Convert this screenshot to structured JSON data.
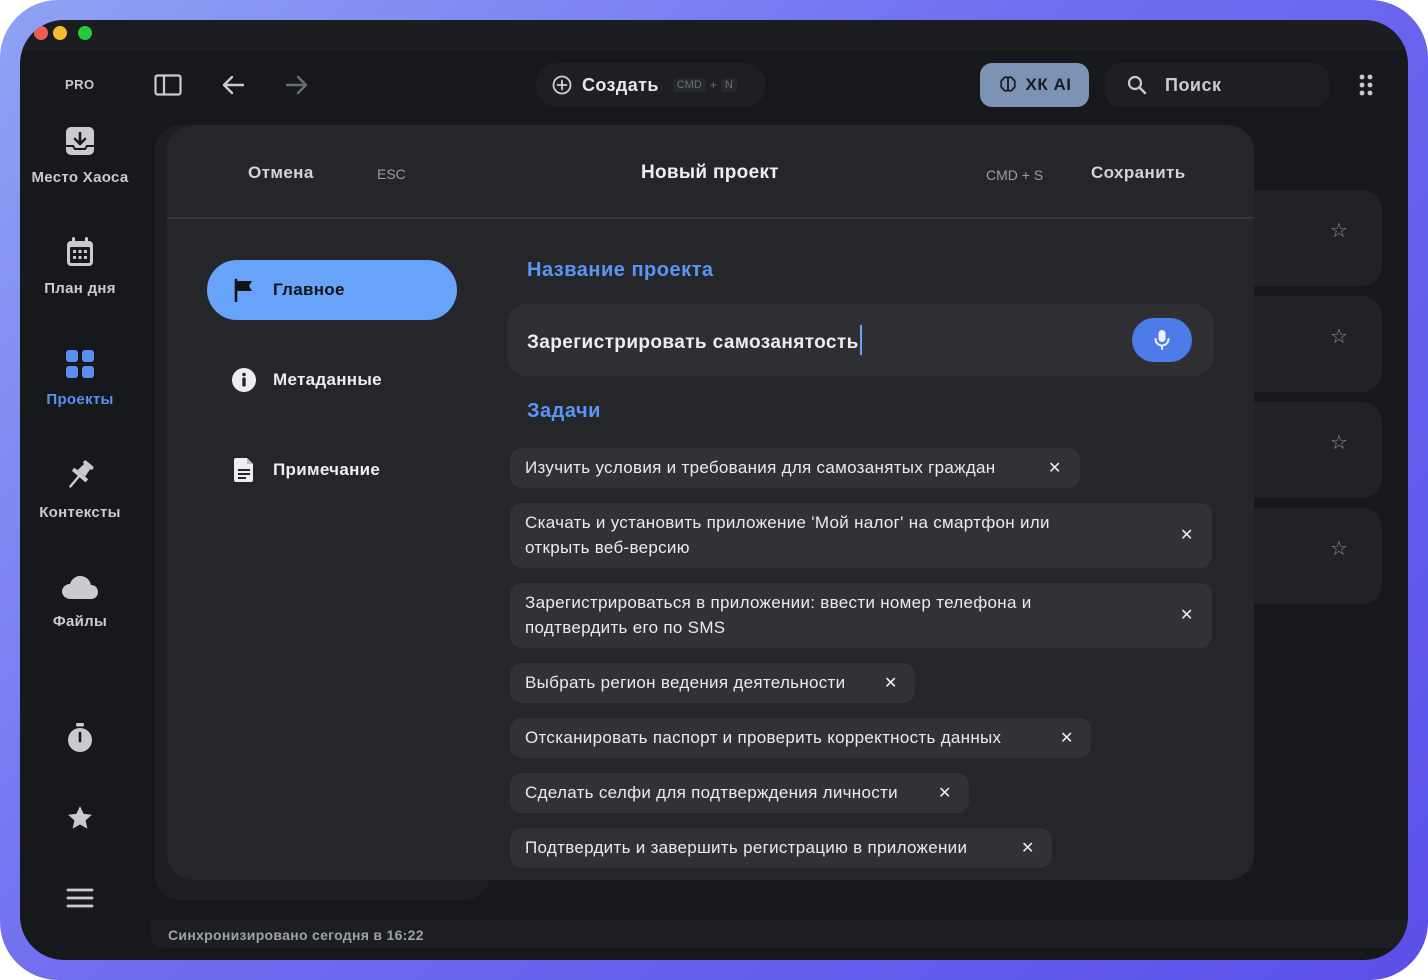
{
  "app": {
    "plan_badge": "PRO",
    "status": "Синхронизировано сегодня в 16:22"
  },
  "toolbar": {
    "create_label": "Создать",
    "create_shortcut_1": "CMD",
    "create_shortcut_plus": "+",
    "create_shortcut_2": "N",
    "ai_label": "ХК AI",
    "search_placeholder": "Поиск"
  },
  "sidebar": {
    "items": [
      {
        "label": "Место Хаоса",
        "icon": "inbox-icon"
      },
      {
        "label": "План дня",
        "icon": "calendar-icon"
      },
      {
        "label": "Проекты",
        "icon": "grid-icon",
        "active": true
      },
      {
        "label": "Контексты",
        "icon": "pin-icon"
      },
      {
        "label": "Файлы",
        "icon": "cloud-icon"
      }
    ],
    "bottom_icons": [
      "timer-icon",
      "star-icon",
      "menu-icon"
    ]
  },
  "dialog": {
    "cancel_label": "Отмена",
    "cancel_shortcut": "ESC",
    "title": "Новый проект",
    "save_shortcut": "CMD + S",
    "save_label": "Сохранить",
    "nav": [
      {
        "label": "Главное",
        "icon": "flag-icon",
        "active": true
      },
      {
        "label": "Метаданные",
        "icon": "info-icon"
      },
      {
        "label": "Примечание",
        "icon": "document-icon"
      }
    ],
    "name_section": "Название проекта",
    "name_value": "Зарегистрировать самозанятость",
    "tasks_section": "Задачи",
    "tasks": [
      "Изучить условия и требования для самозанятых граждан",
      "Скачать и установить приложение 'Мой налог' на смартфон или",
      "открыть веб-версию",
      "Зарегистрироваться в приложении: ввести номер телефона и",
      "подтвердить его по SMS",
      "Выбрать регион ведения деятельности",
      "Отсканировать паспорт и проверить корректность данных",
      "Сделать селфи для подтверждения личности",
      "Подтвердить и завершить регистрацию в приложении"
    ]
  },
  "colors": {
    "accent": "#5a96f5",
    "active_nav": "#67a3f9",
    "mic": "#4d7ce8",
    "ai_button": "#7d93b5",
    "background": "#17181b",
    "frame": "#6f6cf0"
  }
}
